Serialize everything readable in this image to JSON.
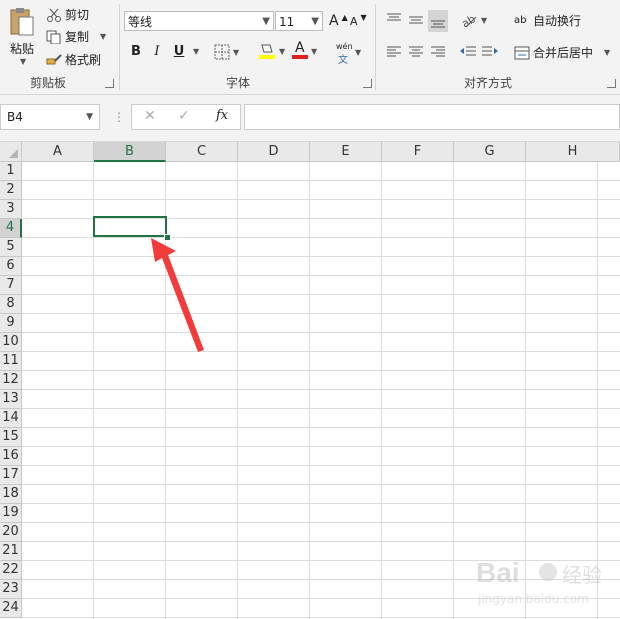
{
  "clipboard": {
    "paste_label": "粘贴",
    "cut_label": "剪切",
    "copy_label": "复制",
    "format_painter_label": "格式刷",
    "group_label": "剪贴板"
  },
  "font": {
    "name": "等线",
    "size": "11",
    "bold": "B",
    "italic": "I",
    "underline": "U",
    "font_color_glyph": "A",
    "phonetic_top": "wén",
    "phonetic_bottom": "文",
    "grow_glyph": "A",
    "shrink_glyph": "A",
    "group_label": "字体"
  },
  "alignment": {
    "wrap_text_label": "自动换行",
    "wrap_glyph": "ab",
    "merge_center_label": "合并后居中",
    "group_label": "对齐方式"
  },
  "formula_bar": {
    "name_box": "B4",
    "cancel_glyph": "✕",
    "enter_glyph": "✓",
    "fx_glyph": "fx",
    "formula": ""
  },
  "sheet": {
    "columns": [
      "A",
      "B",
      "C",
      "D",
      "E",
      "F",
      "G",
      "H"
    ],
    "rows": [
      "1",
      "2",
      "3",
      "4",
      "5",
      "6",
      "7",
      "8",
      "9",
      "10",
      "11",
      "12",
      "13",
      "14",
      "15",
      "16",
      "17",
      "18",
      "19",
      "20",
      "21",
      "22",
      "23",
      "24"
    ],
    "selected_column": "B",
    "selected_row": "4"
  },
  "colors": {
    "accent": "#217346",
    "arrow": "#f23c3c",
    "fill_highlight": "#ffff00",
    "font_color_bar": "#e02020"
  },
  "icons": [
    "paste-icon",
    "cut-icon",
    "copy-icon",
    "format-painter-icon",
    "borders-icon",
    "fill-color-icon",
    "font-color-icon",
    "wrap-text-icon",
    "merge-center-icon",
    "orientation-icon",
    "indent-icon",
    "outdent-icon"
  ]
}
